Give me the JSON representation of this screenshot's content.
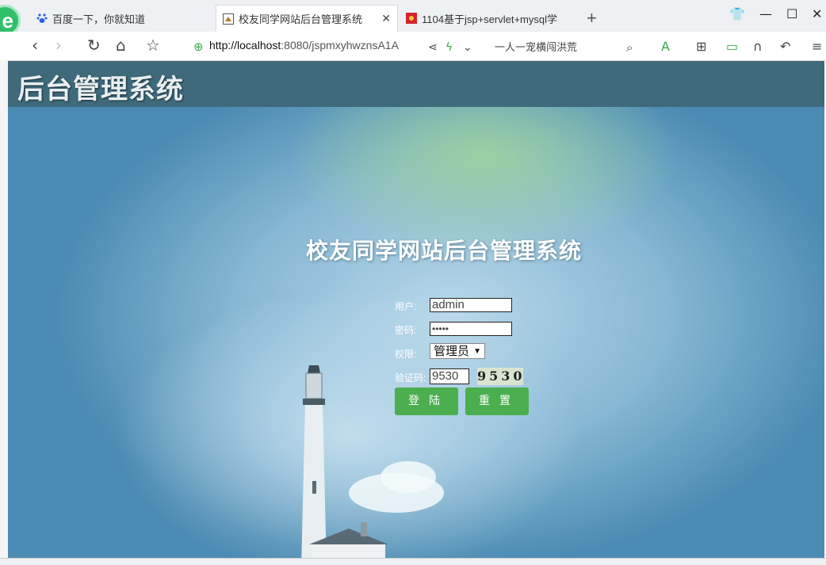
{
  "browser": {
    "tabs": [
      {
        "label": "百度一下，你就知道"
      },
      {
        "label": "校友同学网站后台管理系统"
      },
      {
        "label": "1104基于jsp+servlet+mysql学"
      }
    ],
    "url_host": "http://localhost",
    "url_rest": ":8080/jspmxyhwznsA1A",
    "search_text": "一人一宠横闯洪荒"
  },
  "header": {
    "title": "后台管理系统"
  },
  "login": {
    "title": "校友同学网站后台管理系统",
    "user_label": "用户:",
    "user_value": "admin",
    "password_label": "密码:",
    "password_value": "•••••",
    "role_label": "权限:",
    "role_value": "管理员",
    "captcha_label": "验证码:",
    "captcha_input": "9530",
    "captcha_image": "9530",
    "login_button": "登陆",
    "reset_button": "重置"
  },
  "colors": {
    "header_bg": "#3e6a7c",
    "button_bg": "#4bae4f"
  }
}
